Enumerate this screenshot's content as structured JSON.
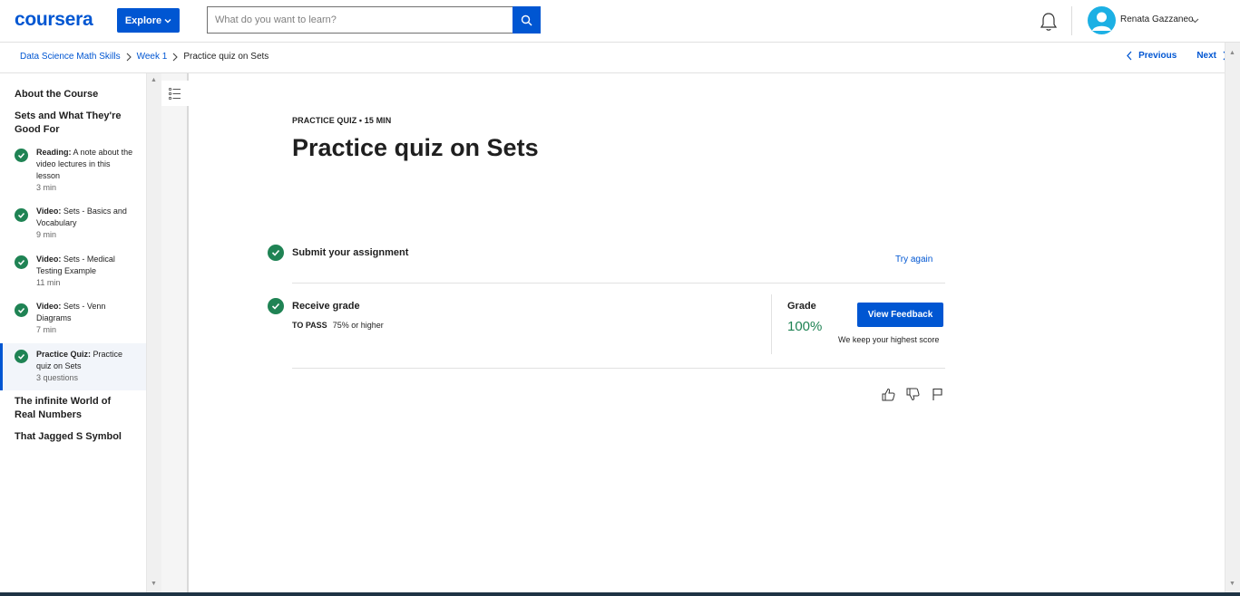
{
  "header": {
    "logo": "coursera",
    "explore_label": "Explore",
    "search_placeholder": "What do you want to learn?",
    "user_name": "Renata Gazzaneo"
  },
  "breadcrumb": {
    "items": [
      "Data Science Math Skills",
      "Week 1"
    ],
    "current": "Practice quiz on Sets",
    "previous_label": "Previous",
    "next_label": "Next"
  },
  "sidebar": {
    "sections": [
      {
        "title": "About the Course"
      },
      {
        "title": "Sets and What They're Good For"
      },
      {
        "title": "The infinite World of Real Numbers"
      },
      {
        "title": "That Jagged S Symbol"
      }
    ],
    "items": [
      {
        "type": "Reading:",
        "name": "A note about the video lectures in this lesson",
        "meta": "3 min",
        "completed": true
      },
      {
        "type": "Video:",
        "name": "Sets - Basics and Vocabulary",
        "meta": "9 min",
        "completed": true
      },
      {
        "type": "Video:",
        "name": "Sets - Medical Testing Example",
        "meta": "11 min",
        "completed": true
      },
      {
        "type": "Video:",
        "name": "Sets - Venn Diagrams",
        "meta": "7 min",
        "completed": true
      },
      {
        "type": "Practice Quiz:",
        "name": "Practice quiz on Sets",
        "meta": "3 questions",
        "completed": true,
        "active": true
      }
    ]
  },
  "main": {
    "eyebrow": "PRACTICE QUIZ • 15 MIN",
    "title": "Practice quiz on Sets",
    "submit_label": "Submit your assignment",
    "try_again_label": "Try again",
    "receive_label": "Receive grade",
    "to_pass_label": "TO PASS",
    "to_pass_value": "75% or higher",
    "grade_label": "Grade",
    "grade_value": "100%",
    "view_feedback_label": "View Feedback",
    "keep_highest": "We keep your highest score"
  },
  "colors": {
    "brand": "#0056d2",
    "success": "#1f8354"
  }
}
